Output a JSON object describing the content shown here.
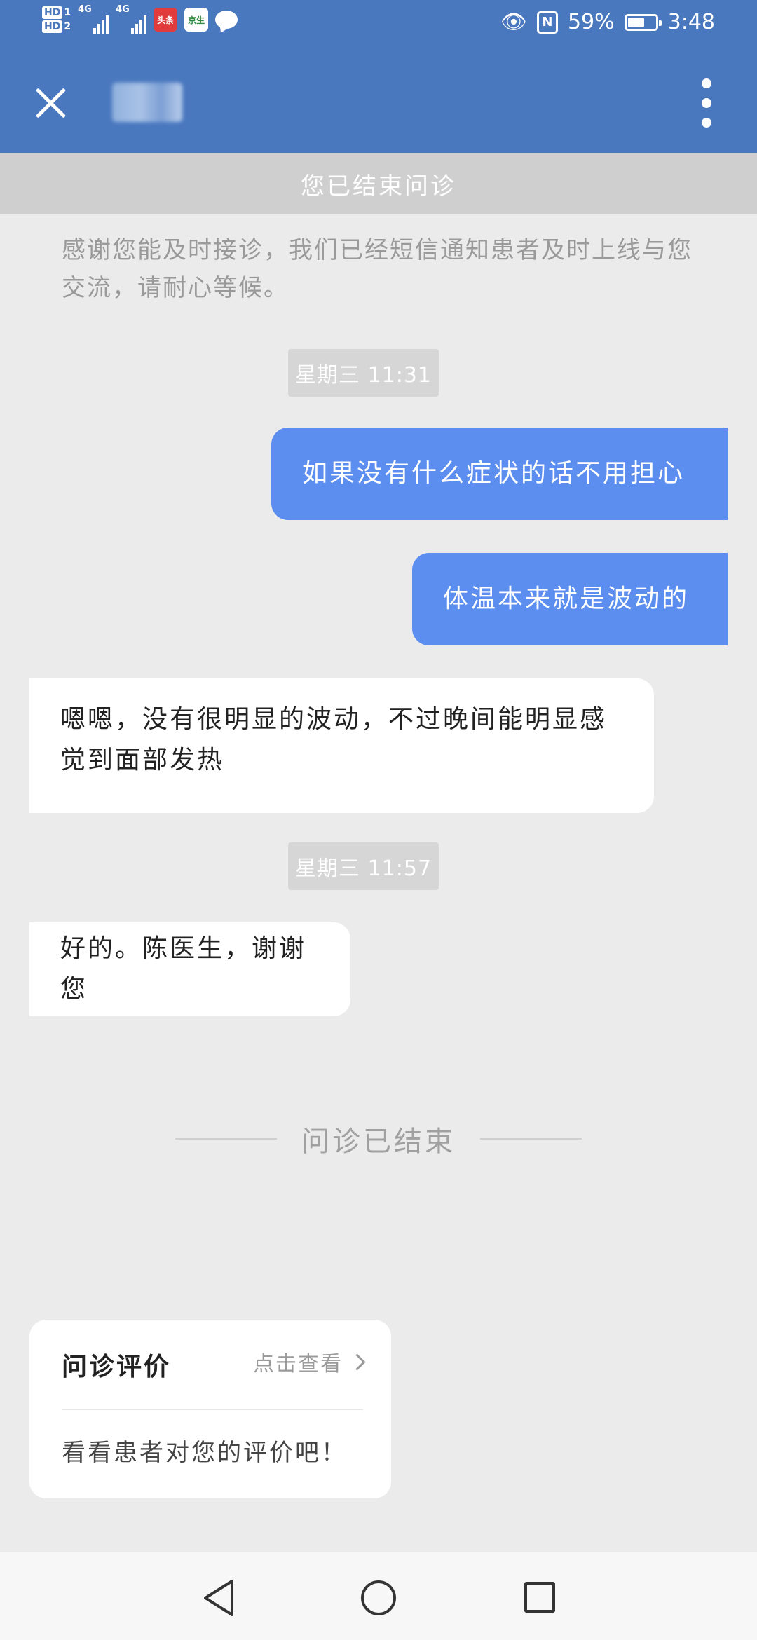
{
  "status_bar": {
    "hd1": "HD",
    "hd1_num": "1",
    "hd2": "HD",
    "hd2_num": "2",
    "signal1": "4G",
    "signal2": "4G",
    "app1": "头条",
    "app2": "京生",
    "battery": "59%",
    "time": "3:48",
    "icons": [
      "eye-icon",
      "nfc-icon",
      "battery-icon",
      "message-icon"
    ]
  },
  "header": {
    "close_icon": "close-icon",
    "more_icon": "more-vertical-icon"
  },
  "banner": {
    "text": "您已结束问诊"
  },
  "system_note": "感谢您能及时接诊，我们已经短信通知患者及时上线与您交流，请耐心等候。",
  "messages": [
    {
      "type": "timestamp",
      "text": "星期三 11:31"
    },
    {
      "type": "out",
      "text": "如果没有什么症状的话不用担心"
    },
    {
      "type": "out",
      "text": "体温本来就是波动的"
    },
    {
      "type": "in",
      "text": "嗯嗯，没有很明显的波动，不过晚间能明显感觉到面部发热"
    },
    {
      "type": "timestamp",
      "text": "星期三 11:57"
    },
    {
      "type": "in",
      "text": "好的。陈医生，谢谢您"
    }
  ],
  "divider": {
    "text": "问诊已结束"
  },
  "review_card": {
    "title": "问诊评价",
    "link": "点击查看",
    "description": "看看患者对您的评价吧！"
  },
  "navbar": {
    "icons": [
      "back-icon",
      "home-icon",
      "recent-apps-icon"
    ]
  },
  "colors": {
    "header": "#4a78bf",
    "outgoing": "#5c8ef0",
    "background": "#ebebeb"
  }
}
